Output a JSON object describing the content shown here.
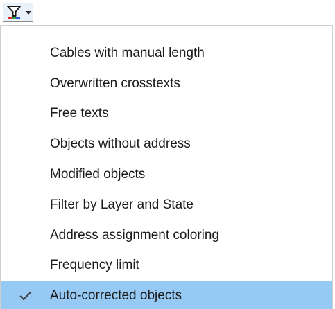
{
  "toolbar": {
    "filter_button": {
      "icon": "filter-icon",
      "dropdown_icon": "chevron-down-icon",
      "colors": {
        "funnel_outline": "#1a1a1a",
        "funnel_fill": "#ffffff",
        "base_red": "#d62b2b",
        "base_green": "#2fa33a",
        "base_blue": "#2b55d6",
        "button_bg": "#e9f1fb",
        "button_border": "#8a8a8a"
      }
    }
  },
  "menu": {
    "items": [
      {
        "label": "Cables with manual length",
        "checked": false
      },
      {
        "label": "Overwritten crosstexts",
        "checked": false
      },
      {
        "label": "Free texts",
        "checked": false
      },
      {
        "label": "Objects without address",
        "checked": false
      },
      {
        "label": "Modified objects",
        "checked": false
      },
      {
        "label": "Filter by Layer and State",
        "checked": false
      },
      {
        "label": "Address assignment coloring",
        "checked": false
      },
      {
        "label": "Frequency limit",
        "checked": false
      },
      {
        "label": "Auto-corrected objects",
        "checked": true
      }
    ],
    "selected_item_bg": "#97c9f5",
    "check_icon": "check-icon"
  }
}
